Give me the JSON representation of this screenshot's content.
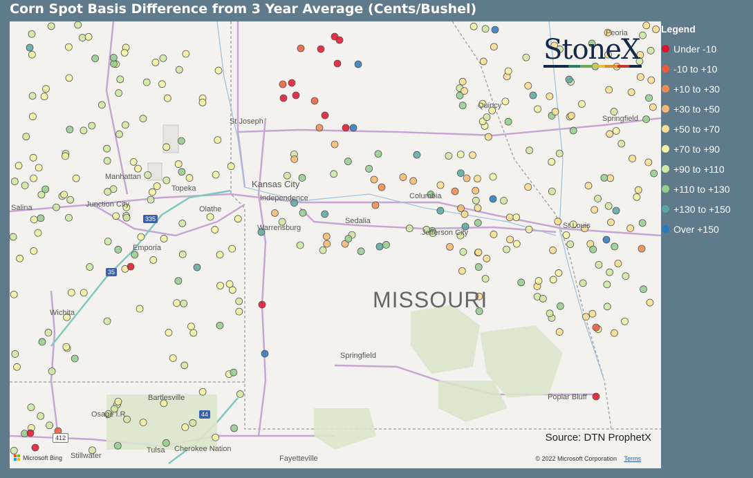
{
  "title": "Corn Spot Basis Difference from 3 Year Average (Cents/Bushel)",
  "legend": {
    "title": "Legend",
    "items": [
      {
        "label": "Under -10",
        "color": "#e0122a"
      },
      {
        "label": "-10 to +10",
        "color": "#ea5c3c"
      },
      {
        "label": "+10 to +30",
        "color": "#f08a4b"
      },
      {
        "label": "+30 to +50",
        "color": "#f5b870"
      },
      {
        "label": "+50 to +70",
        "color": "#f9dd8e"
      },
      {
        "label": "+70 to +90",
        "color": "#f3f2a0"
      },
      {
        "label": "+90 to +110",
        "color": "#cfe7a0"
      },
      {
        "label": "+110 to +130",
        "color": "#93cd8c"
      },
      {
        "label": "+130 to +150",
        "color": "#5aa7a0"
      },
      {
        "label": "Over +150",
        "color": "#2a78bd"
      }
    ]
  },
  "logo": {
    "text": "StoneX"
  },
  "map_labels": {
    "state": "MISSOURI",
    "cities": [
      "St Joseph",
      "Manhattan",
      "Topeka",
      "Kansas City",
      "Independence",
      "Junction City",
      "Salina",
      "Olathe",
      "Columbia",
      "Sedalia",
      "Warrensburg",
      "Jefferson City",
      "Emporia",
      "Wichita",
      "Springfield",
      "Bartlesville",
      "Osage I.R.",
      "Cherokee Nation",
      "Tulsa",
      "Stillwater",
      "Fayetteville",
      "Poplar Bluff",
      "St Louis",
      "Springfield",
      "Peoria",
      "Quincy"
    ],
    "highways": [
      "335",
      "35",
      "44",
      "412"
    ]
  },
  "source": "Source: DTN ProphetX",
  "copyright": "© 2022 Microsoft Corporation",
  "terms": "Terms",
  "bing": "Microsoft Bing"
}
